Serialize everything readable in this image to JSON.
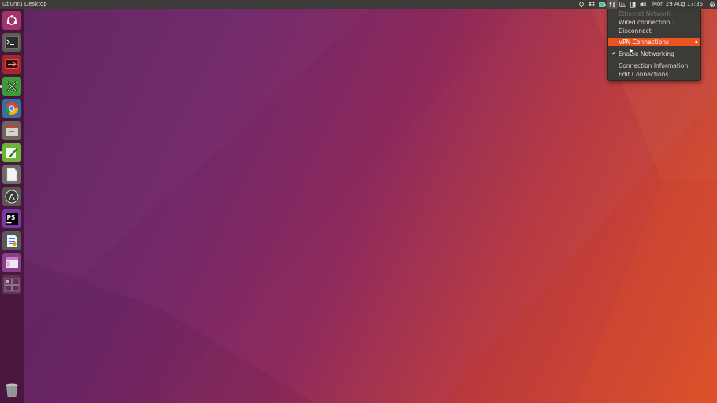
{
  "topbar": {
    "title": "Ubuntu Desktop",
    "clock": "Mon 29 Aug 17:36"
  },
  "network_menu": {
    "section_header": "Ethernet Network",
    "items": [
      {
        "label": "Wired connection 1"
      },
      {
        "label": "Disconnect"
      },
      {
        "label": "VPN Connections",
        "highlighted": true,
        "submenu": true
      },
      {
        "label": "Enable Networking",
        "checked": true
      },
      {
        "label": "Connection Information"
      },
      {
        "label": "Edit Connections..."
      }
    ]
  },
  "launcher": {
    "items": [
      {
        "name": "dash-home",
        "icon": "ubuntu-logo-icon"
      },
      {
        "name": "terminal",
        "icon": "terminal-icon"
      },
      {
        "name": "remote-app",
        "icon": "remote-desktop-icon"
      },
      {
        "name": "x-app",
        "icon": "x-app-icon"
      },
      {
        "name": "chrome",
        "icon": "chrome-icon"
      },
      {
        "name": "files",
        "icon": "file-cabinet-icon"
      },
      {
        "name": "text-editor",
        "icon": "pencil-editor-icon"
      },
      {
        "name": "document",
        "icon": "blank-document-icon"
      },
      {
        "name": "software-updater",
        "icon": "software-updater-icon"
      },
      {
        "name": "phpstorm",
        "icon": "phpstorm-icon"
      },
      {
        "name": "writer",
        "icon": "writer-doc-icon"
      },
      {
        "name": "window-app",
        "icon": "window-app-icon"
      },
      {
        "name": "workspace-switcher",
        "icon": "workspace-switcher-icon"
      },
      {
        "name": "trash",
        "icon": "trash-icon"
      }
    ]
  },
  "colors": {
    "panel": "#3c3b37",
    "highlight": "#e95420",
    "menu_text": "#dfdbd2"
  }
}
